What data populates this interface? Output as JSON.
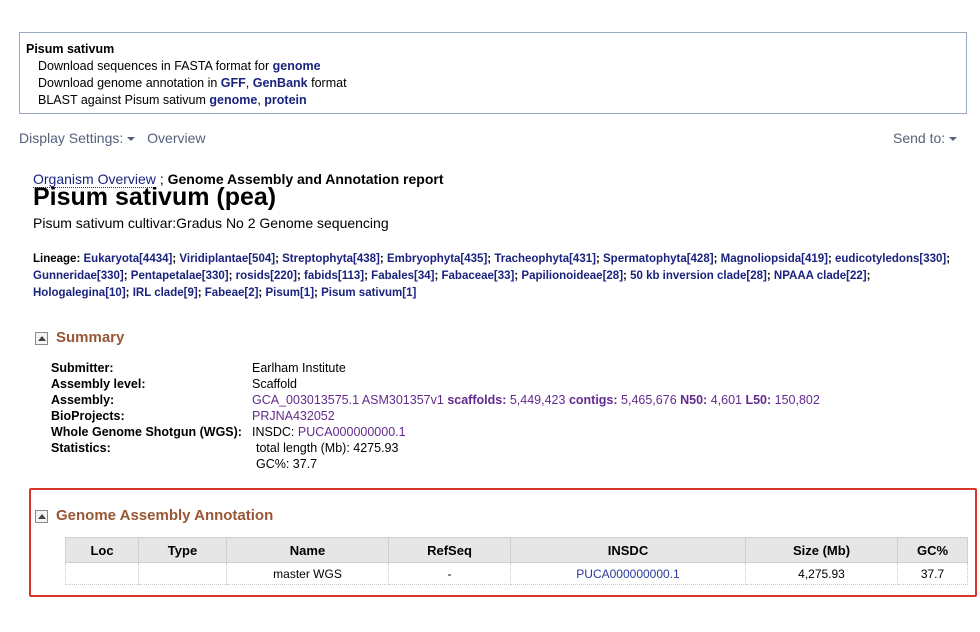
{
  "header_box": {
    "title": "Pisum sativum",
    "line1_text": "Download sequences in FASTA format for",
    "line1_link": "genome",
    "line2_text": "Download genome annotation in",
    "line2_link_gff": "GFF",
    "line2_sep": ",",
    "line2_link_genbank": "GenBank",
    "line2_suffix": "format",
    "line3_text": "BLAST against Pisum sativum",
    "line3_link_genome": "genome",
    "line3_sep": ",",
    "line3_link_protein": "protein"
  },
  "display_bar": {
    "display_settings": "Display Settings:",
    "mode": "Overview",
    "send_to": "Send to:"
  },
  "breadcrumb": {
    "link": "Organism Overview",
    "sep": ";",
    "current": "Genome Assembly and Annotation report"
  },
  "title": "Pisum sativum (pea)",
  "subtitle": "Pisum sativum cultivar:Gradus No 2 Genome sequencing",
  "lineage": {
    "label": "Lineage:",
    "items": [
      "Eukaryota[4434]",
      "Viridiplantae[504]",
      "Streptophyta[438]",
      "Embryophyta[435]",
      "Tracheophyta[431]",
      "Spermatophyta[428]",
      "Magnoliopsida[419]",
      "eudicotyledons[330]",
      "Gunneridae[330]",
      "Pentapetalae[330]",
      "rosids[220]",
      "fabids[113]",
      "Fabales[34]",
      "Fabaceae[33]",
      "Papilionoideae[28]",
      "50 kb inversion clade[28]",
      "NPAAA clade[22]",
      "Hologalegina[10]",
      "IRL clade[9]",
      "Fabeae[2]",
      "Pisum[1]",
      "Pisum sativum[1]"
    ]
  },
  "summary": {
    "heading": "Summary",
    "submitter_label": "Submitter:",
    "submitter": "Earlham Institute",
    "level_label": "Assembly level:",
    "level": "Scaffold",
    "assembly_label": "Assembly:",
    "assembly_link": "GCA_003013575.1 ASM301357v1",
    "scaffolds_label": "scaffolds:",
    "scaffolds": "5,449,423",
    "contigs_label": "contigs:",
    "contigs": "5,465,676",
    "n50_label": "N50:",
    "n50": "4,601",
    "l50_label": "L50:",
    "l50": "150,802",
    "bioprojects_label": "BioProjects:",
    "bioprojects": "PRJNA432052",
    "wgs_label": "Whole Genome Shotgun (WGS):",
    "wgs_prefix": "INSDC:",
    "wgs": "PUCA000000000.1",
    "stats_label": "Statistics:",
    "total_length": "total length (Mb): 4275.93",
    "gc": "GC%: 37.7"
  },
  "annotation": {
    "heading": "Genome Assembly Annotation",
    "columns": [
      "Loc",
      "Type",
      "Name",
      "RefSeq",
      "INSDC",
      "Size (Mb)",
      "GC%"
    ],
    "row": {
      "loc": "",
      "type": "",
      "name": "master WGS",
      "refseq": "-",
      "insdc": "PUCA000000000.1",
      "size": "4,275.93",
      "gc": "37.7"
    }
  },
  "colors": {
    "link": "#1a237e",
    "section_heading": "#985735",
    "highlight_border": "#d9362b",
    "stat_link": "#642a8f"
  }
}
